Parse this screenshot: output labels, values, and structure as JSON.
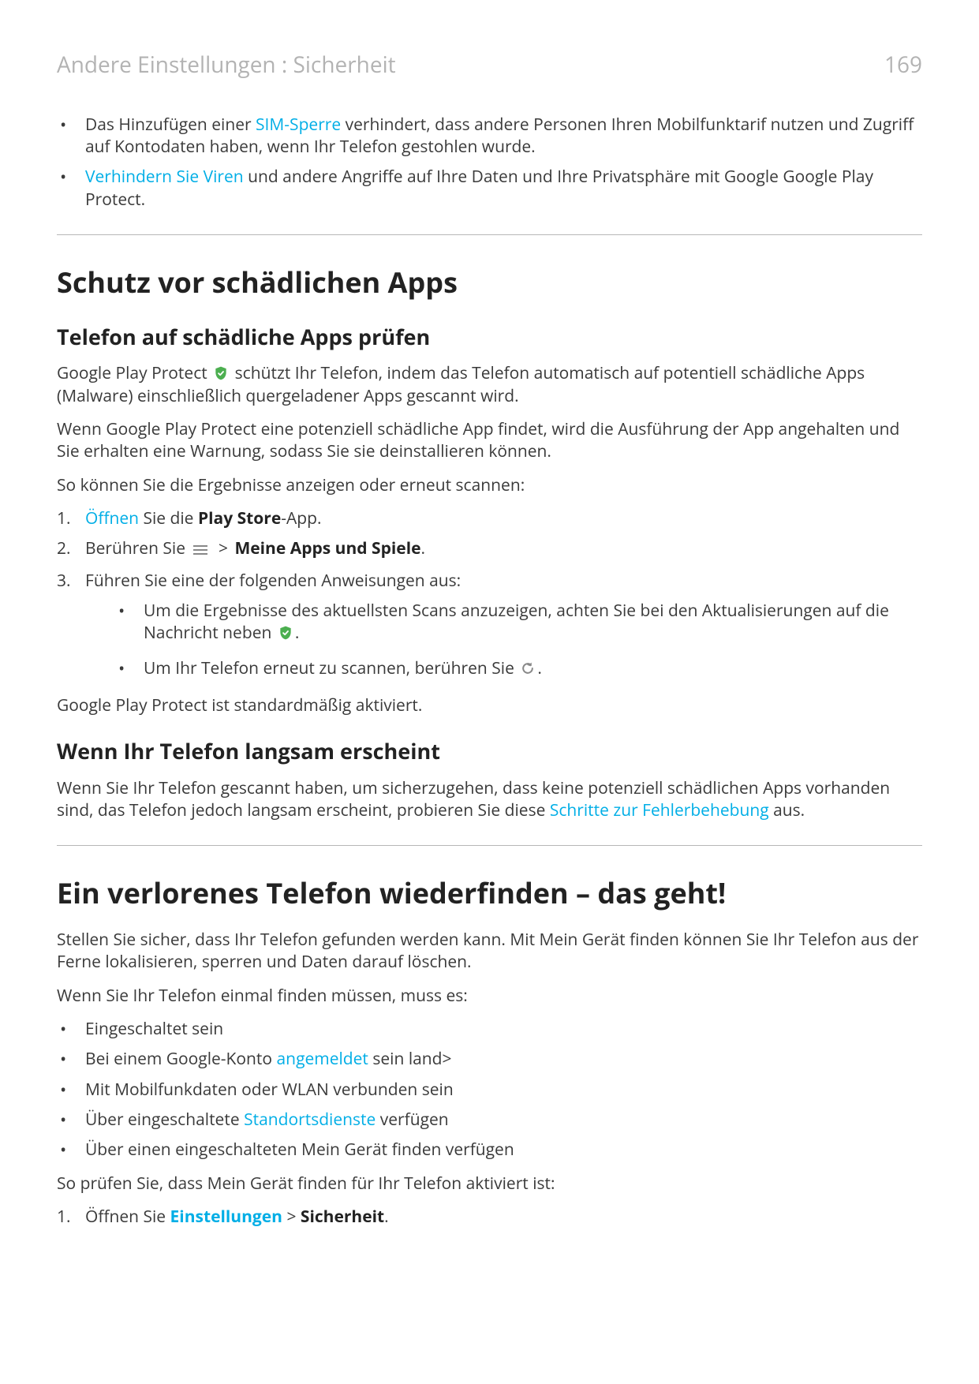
{
  "header": {
    "breadcrumb": "Andere Einstellungen : Sicherheit",
    "page_number": "169"
  },
  "intro_bullets": {
    "b1_pre": "Das Hinzufügen einer ",
    "b1_link": "SIM-Sperre",
    "b1_post": " verhindert, dass andere Personen Ihren Mobilfunktarif nutzen und Zugriff auf Kontodaten haben, wenn Ihr Telefon gestohlen wurde.",
    "b2_link": "Verhindern Sie Viren",
    "b2_post": " und andere Angriffe auf Ihre Daten und Ihre Privatsphäre mit Google Google Play Protect."
  },
  "sec1": {
    "title": "Schutz vor schädlichen Apps",
    "h_check": "Telefon auf schädliche Apps prüfen",
    "p1_a": "Google Play Protect ",
    "p1_b": " schützt Ihr Telefon, indem das Telefon automatisch auf potentiell schädliche Apps (Malware) einschließlich quergeladener Apps gescannt wird.",
    "p2": "Wenn Google Play Protect eine potenziell schädliche App findet, wird die Ausführung der App angehalten und Sie erhalten eine Warnung, sodass Sie sie deinstallieren können.",
    "p3": "So können Sie die Ergebnisse anzeigen oder erneut scannen:",
    "step1_link": "Öffnen",
    "step1_mid": " Sie die ",
    "step1_bold": "Play Store",
    "step1_post": "-App.",
    "step2_a": "Berühren Sie ",
    "step2_gt": ">",
    "step2_bold": "Meine Apps und Spiele",
    "step2_post": ".",
    "step3": "Führen Sie eine der folgenden Anweisungen aus:",
    "step3_sub1_a": "Um die Ergebnisse des aktuellsten Scans anzuzeigen, achten Sie bei den Aktualisierungen auf die Nachricht neben ",
    "step3_sub1_b": ".",
    "step3_sub2_a": "Um Ihr Telefon erneut zu scannen, berühren Sie ",
    "step3_sub2_b": ".",
    "p4": "Google Play Protect ist standardmäßig aktiviert.",
    "h_slow": "Wenn Ihr Telefon langsam erscheint",
    "p_slow_a": "Wenn Sie Ihr Telefon gescannt haben, um sicherzugehen, dass keine potenziell schädlichen Apps vorhanden sind, das Telefon jedoch langsam erscheint, probieren Sie diese ",
    "p_slow_link": "Schritte zur Fehlerbehebung",
    "p_slow_b": " aus."
  },
  "sec2": {
    "title": "Ein verlorenes Telefon wiederfinden – das geht!",
    "p1": "Stellen Sie sicher, dass Ihr Telefon gefunden werden kann. Mit Mein Gerät finden können Sie Ihr Telefon aus der Ferne lokalisieren, sperren und Daten darauf löschen.",
    "p2": "Wenn Sie Ihr Telefon einmal finden müssen, muss es:",
    "b1": "Eingeschaltet sein",
    "b2_a": "Bei einem Google-Konto ",
    "b2_link": "angemeldet",
    "b2_b": " sein",
    "b3": "Mit Mobilfunkdaten oder WLAN verbunden sein",
    "b4_a": "Über eingeschaltete ",
    "b4_link": "Standortsdienste",
    "b4_b": " verfügen",
    "b5": "Über einen eingeschalteten Mein Gerät finden verfügen",
    "p3": "So prüfen Sie, dass Mein Gerät finden für Ihr Telefon aktiviert ist:",
    "n1_a": "Öffnen Sie ",
    "n1_link": "Einstellungen",
    "n1_gt": " > ",
    "n1_bold": "Sicherheit",
    "n1_post": "."
  },
  "icons": {
    "shield_check": "verified-shield-icon",
    "menu": "hamburger-menu-icon",
    "refresh": "refresh-icon"
  },
  "colors": {
    "link": "#00aee6",
    "accent_green": "#4CAF50"
  }
}
